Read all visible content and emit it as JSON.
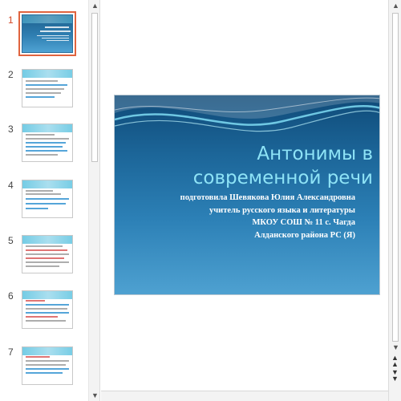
{
  "thumbnails": [
    {
      "number": "1",
      "selected": true
    },
    {
      "number": "2",
      "selected": false
    },
    {
      "number": "3",
      "selected": false
    },
    {
      "number": "4",
      "selected": false
    },
    {
      "number": "5",
      "selected": false
    },
    {
      "number": "6",
      "selected": false
    },
    {
      "number": "7",
      "selected": false
    }
  ],
  "slide": {
    "title_line1": "Антонимы в",
    "title_line2": "современной речи",
    "subtitle_line1": "подготовила Шевякова Юлия Александровна",
    "subtitle_line2": "учитель русского языка и литературы",
    "subtitle_line3": "МКОУ СОШ № 11 с. Чагда",
    "subtitle_line4": "Алданского района РС (Я)"
  },
  "colors": {
    "accent": "#e0643f",
    "slide_bg": "#1c6699",
    "title": "#8ee3f6"
  },
  "icons": {
    "scroll_up": "triangle-up-icon",
    "scroll_down": "triangle-down-icon",
    "previous_slide": "double-up-arrow-icon",
    "next_slide": "double-down-arrow-icon"
  }
}
